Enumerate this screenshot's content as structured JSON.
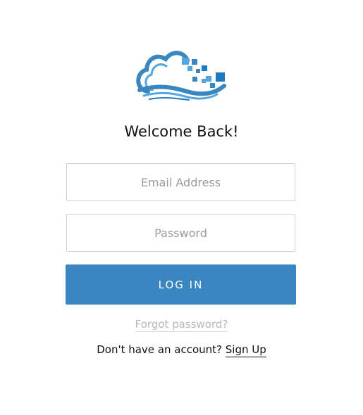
{
  "brand": {
    "logo_icon": "cloud-logo-icon",
    "primary_color": "#3a86c0",
    "light_blue": "#54a6e0",
    "accent_blue": "#1f78c2"
  },
  "login": {
    "title": "Welcome Back!",
    "email_placeholder": "Email Address",
    "password_placeholder": "Password",
    "login_label": "LOG IN",
    "forgot_label": "Forgot password?",
    "no_account_text": "Don't have an account?",
    "signup_label": "Sign Up"
  }
}
